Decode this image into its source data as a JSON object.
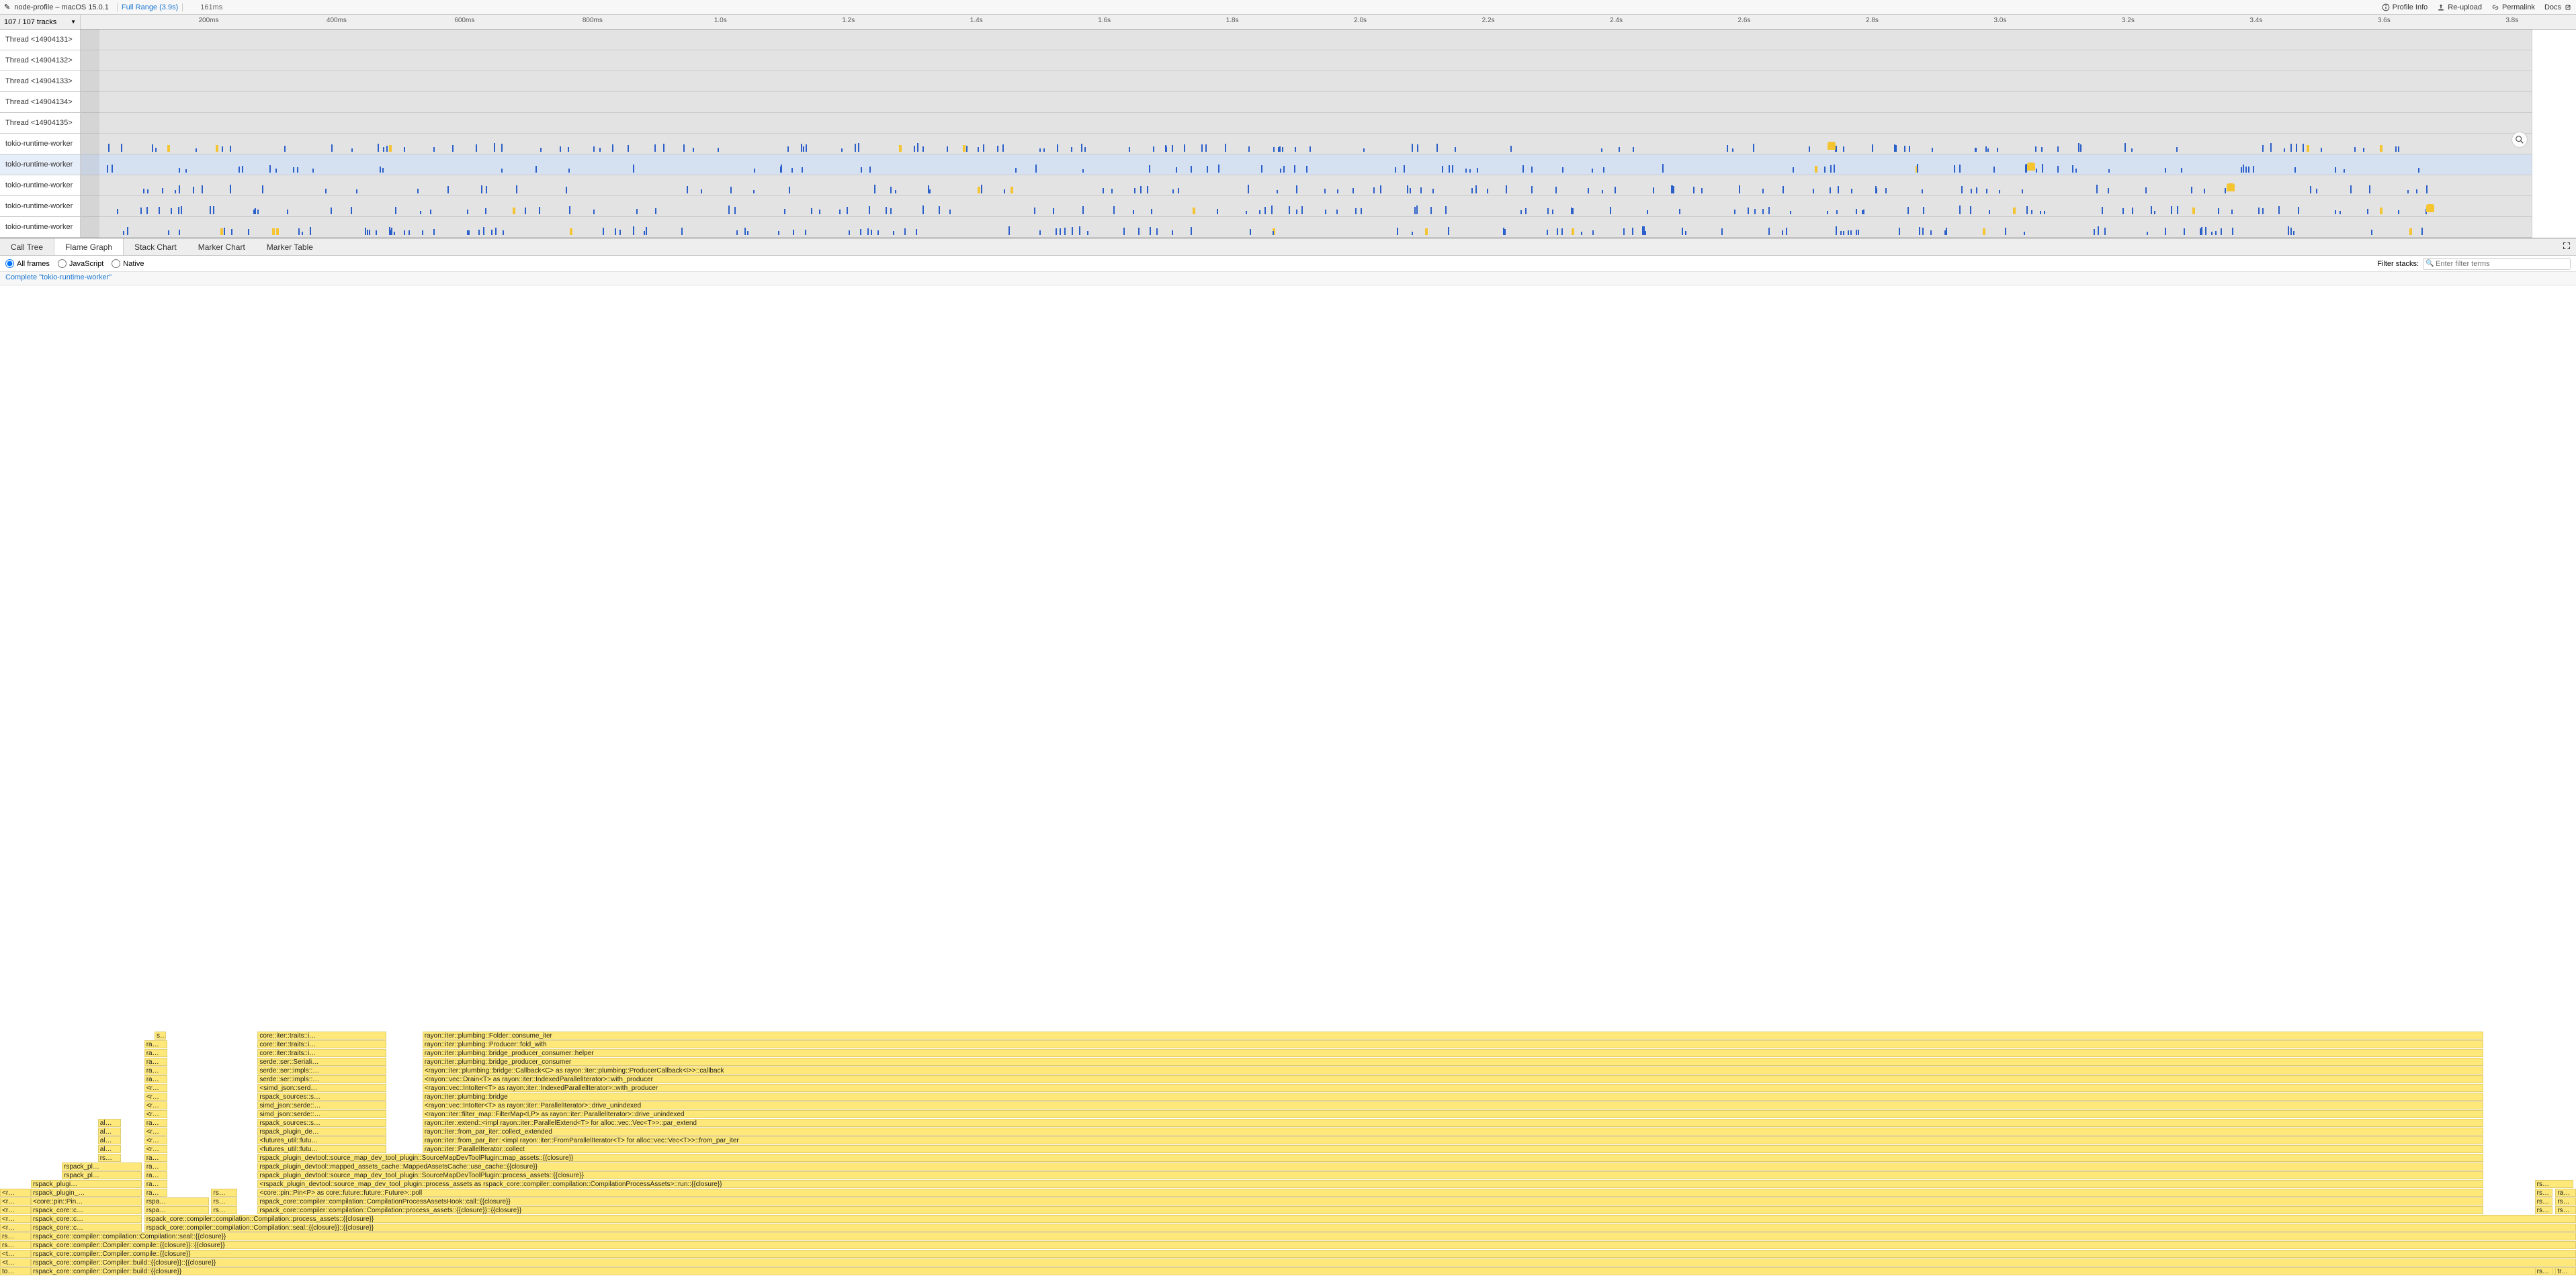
{
  "header": {
    "title": "node-profile – macOS 15.0.1",
    "range_link": "Full Range (3.9s)",
    "duration": "161ms",
    "actions": {
      "profile_info": "Profile Info",
      "reupload": "Re-upload",
      "permalink": "Permalink",
      "docs": "Docs"
    }
  },
  "tracks_label": "107 / 107 tracks",
  "ruler_ticks": [
    "200ms",
    "400ms",
    "600ms",
    "800ms",
    "1.0s",
    "1.2s",
    "1.4s",
    "1.6s",
    "1.8s",
    "2.0s",
    "2.2s",
    "2.4s",
    "2.6s",
    "2.8s",
    "3.0s",
    "3.2s",
    "3.4s",
    "3.6s",
    "3.8s"
  ],
  "tracks": [
    {
      "name": "Thread <14904131>",
      "type": "thread"
    },
    {
      "name": "Thread <14904132>",
      "type": "thread"
    },
    {
      "name": "Thread <14904133>",
      "type": "thread"
    },
    {
      "name": "Thread <14904134>",
      "type": "thread"
    },
    {
      "name": "Thread <14904135>",
      "type": "thread"
    },
    {
      "name": "tokio-runtime-worker",
      "type": "worker",
      "selected": false
    },
    {
      "name": "tokio-runtime-worker",
      "type": "worker",
      "selected": true
    },
    {
      "name": "tokio-runtime-worker",
      "type": "worker",
      "selected": false
    },
    {
      "name": "tokio-runtime-worker",
      "type": "worker",
      "selected": false
    },
    {
      "name": "tokio-runtime-worker",
      "type": "worker",
      "selected": false
    }
  ],
  "bottom_tabs": [
    "Call Tree",
    "Flame Graph",
    "Stack Chart",
    "Marker Chart",
    "Marker Table"
  ],
  "bottom_active_tab": "Flame Graph",
  "filter": {
    "opts": {
      "all": "All frames",
      "js": "JavaScript",
      "native": "Native"
    },
    "selected": "all",
    "label": "Filter stacks:",
    "placeholder": "Enter filter terms"
  },
  "crumb": "Complete \"tokio-runtime-worker\"",
  "flame_rows": [
    [
      {
        "l": 6.0,
        "w": 0.45,
        "t": "st…"
      },
      {
        "l": 10.0,
        "w": 5.0,
        "t": "core::iter::traits::i…"
      },
      {
        "l": 16.4,
        "w": 80,
        "t": "rayon::iter::plumbing::Folder::consume_iter"
      }
    ],
    [
      {
        "l": 5.6,
        "w": 0.9,
        "t": "ra…"
      },
      {
        "l": 10.0,
        "w": 5.0,
        "t": "core::iter::traits::i…"
      },
      {
        "l": 16.4,
        "w": 80,
        "t": "rayon::iter::plumbing::Producer::fold_with"
      }
    ],
    [
      {
        "l": 5.6,
        "w": 0.9,
        "t": "ra…"
      },
      {
        "l": 10.0,
        "w": 5.0,
        "t": "core::iter::traits::i…"
      },
      {
        "l": 16.4,
        "w": 80,
        "t": "rayon::iter::plumbing::bridge_producer_consumer::helper"
      }
    ],
    [
      {
        "l": 5.6,
        "w": 0.9,
        "t": "ra…"
      },
      {
        "l": 10.0,
        "w": 5.0,
        "t": "serde::ser::Seriali…"
      },
      {
        "l": 16.4,
        "w": 80,
        "t": "rayon::iter::plumbing::bridge_producer_consumer"
      }
    ],
    [
      {
        "l": 5.6,
        "w": 0.9,
        "t": "ra…"
      },
      {
        "l": 10.0,
        "w": 5.0,
        "t": "serde::ser::impls::…"
      },
      {
        "l": 16.4,
        "w": 80,
        "t": "<rayon::iter::plumbing::bridge::Callback<C> as rayon::iter::plumbing::ProducerCallback<I>>::callback"
      }
    ],
    [
      {
        "l": 5.6,
        "w": 0.9,
        "t": "ra…"
      },
      {
        "l": 10.0,
        "w": 5.0,
        "t": "serde::ser::impls::…"
      },
      {
        "l": 16.4,
        "w": 80,
        "t": "<rayon::vec::Drain<T> as rayon::iter::IndexedParallelIterator>::with_producer"
      }
    ],
    [
      {
        "l": 5.6,
        "w": 0.9,
        "t": "<r…"
      },
      {
        "l": 10.0,
        "w": 5.0,
        "t": "<simd_json::serd…"
      },
      {
        "l": 16.4,
        "w": 80,
        "t": "<rayon::vec::IntoIter<T> as rayon::iter::IndexedParallelIterator>::with_producer"
      }
    ],
    [
      {
        "l": 5.6,
        "w": 0.9,
        "t": "<r…"
      },
      {
        "l": 10.0,
        "w": 5.0,
        "t": "rspack_sources::s…"
      },
      {
        "l": 16.4,
        "w": 80,
        "t": "rayon::iter::plumbing::bridge"
      }
    ],
    [
      {
        "l": 5.6,
        "w": 0.9,
        "t": "<r…"
      },
      {
        "l": 10.0,
        "w": 5.0,
        "t": "simd_json::serde::…"
      },
      {
        "l": 16.4,
        "w": 80,
        "t": "<rayon::vec::IntoIter<T> as rayon::iter::ParallelIterator>::drive_unindexed"
      }
    ],
    [
      {
        "l": 5.6,
        "w": 0.9,
        "t": "<r…"
      },
      {
        "l": 10.0,
        "w": 5.0,
        "t": "simd_json::serde::…"
      },
      {
        "l": 16.4,
        "w": 80,
        "t": "<rayon::iter::filter_map::FilterMap<I,P> as rayon::iter::ParallelIterator>::drive_unindexed"
      }
    ],
    [
      {
        "l": 3.8,
        "w": 0.9,
        "t": "al…"
      },
      {
        "l": 5.6,
        "w": 0.9,
        "t": "ra…"
      },
      {
        "l": 10.0,
        "w": 5.0,
        "t": "rspack_sources::s…"
      },
      {
        "l": 16.4,
        "w": 80,
        "t": "rayon::iter::extend::<impl rayon::iter::ParallelExtend<T> for alloc::vec::Vec<T>>::par_extend"
      }
    ],
    [
      {
        "l": 3.8,
        "w": 0.9,
        "t": "al…"
      },
      {
        "l": 5.6,
        "w": 0.9,
        "t": "<r…"
      },
      {
        "l": 10.0,
        "w": 5.0,
        "t": "rspack_plugin_de…"
      },
      {
        "l": 16.4,
        "w": 80,
        "t": "rayon::iter::from_par_iter::collect_extended"
      }
    ],
    [
      {
        "l": 3.8,
        "w": 0.9,
        "t": "al…"
      },
      {
        "l": 5.6,
        "w": 0.9,
        "t": "<r…"
      },
      {
        "l": 10.0,
        "w": 5.0,
        "t": "<futures_util::futu…"
      },
      {
        "l": 16.4,
        "w": 80,
        "t": "rayon::iter::from_par_iter::<impl rayon::iter::FromParallelIterator<T> for alloc::vec::Vec<T>>::from_par_iter"
      }
    ],
    [
      {
        "l": 3.8,
        "w": 0.9,
        "t": "al…"
      },
      {
        "l": 5.6,
        "w": 0.9,
        "t": "<r…"
      },
      {
        "l": 10.0,
        "w": 5.0,
        "t": "<futures_util::futu…"
      },
      {
        "l": 16.4,
        "w": 80,
        "t": "rayon::iter::ParallelIterator::collect"
      }
    ],
    [
      {
        "l": 3.8,
        "w": 0.9,
        "t": "rs…"
      },
      {
        "l": 5.6,
        "w": 0.9,
        "t": "ra…"
      },
      {
        "l": 10.0,
        "w": 86.4,
        "t": "rspack_plugin_devtool::source_map_dev_tool_plugin::SourceMapDevToolPlugin::map_assets::{{closure}}"
      }
    ],
    [
      {
        "l": 2.4,
        "w": 3.1,
        "t": "rspack_pl…"
      },
      {
        "l": 5.6,
        "w": 0.9,
        "t": "ra…"
      },
      {
        "l": 10.0,
        "w": 86.4,
        "t": "rspack_plugin_devtool::mapped_assets_cache::MappedAssetsCache::use_cache::{{closure}}"
      }
    ],
    [
      {
        "l": 2.4,
        "w": 3.1,
        "t": "rspack_pl…"
      },
      {
        "l": 5.6,
        "w": 0.9,
        "t": "ra…"
      },
      {
        "l": 10.0,
        "w": 86.4,
        "t": "rspack_plugin_devtool::source_map_dev_tool_plugin::SourceMapDevToolPlugin::process_assets::{{closure}}"
      }
    ],
    [
      {
        "l": 1.2,
        "w": 4.3,
        "t": "rspack_plugi…"
      },
      {
        "l": 5.6,
        "w": 0.9,
        "t": "ra…"
      },
      {
        "l": 10.0,
        "w": 86.4,
        "t": "<rspack_plugin_devtool::source_map_dev_tool_plugin::process_assets as rspack_core::compiler::compilation::CompilationProcessAssets>::run::{{closure}}"
      },
      {
        "l": 98.4,
        "w": 1.5,
        "t": "rs…"
      }
    ],
    [
      {
        "l": 0,
        "w": 1.2,
        "t": "<r…"
      },
      {
        "l": 1.2,
        "w": 4.3,
        "t": "rspack_plugin_…"
      },
      {
        "l": 5.6,
        "w": 0.9,
        "t": "ra…"
      },
      {
        "l": 8.2,
        "w": 1.0,
        "t": "rs…"
      },
      {
        "l": 10.0,
        "w": 86.4,
        "t": "<core::pin::Pin<P> as core::future::future::Future>::poll"
      },
      {
        "l": 98.4,
        "w": 0.7,
        "t": "rs…"
      },
      {
        "l": 99.2,
        "w": 0.8,
        "t": "ra…"
      }
    ],
    [
      {
        "l": 0,
        "w": 1.2,
        "t": "<r…"
      },
      {
        "l": 1.2,
        "w": 4.3,
        "t": "<core::pin::Pin…"
      },
      {
        "l": 5.6,
        "w": 2.5,
        "t": "rspa…"
      },
      {
        "l": 8.2,
        "w": 1.0,
        "t": "rs…"
      },
      {
        "l": 10.0,
        "w": 86.4,
        "t": "rspack_core::compiler::compilation::CompilationProcessAssetsHook::call::{{closure}}"
      },
      {
        "l": 98.4,
        "w": 0.7,
        "t": "rs…"
      },
      {
        "l": 99.2,
        "w": 0.8,
        "t": "rs…"
      }
    ],
    [
      {
        "l": 0,
        "w": 1.2,
        "t": "<r…"
      },
      {
        "l": 1.2,
        "w": 4.3,
        "t": "rspack_core::c…"
      },
      {
        "l": 5.6,
        "w": 2.5,
        "t": "rspa…"
      },
      {
        "l": 8.2,
        "w": 1.0,
        "t": "rs…"
      },
      {
        "l": 10.0,
        "w": 86.4,
        "t": "rspack_core::compiler::compilation::Compilation::process_assets::{{closure}}::{{closure}}"
      },
      {
        "l": 98.4,
        "w": 0.7,
        "t": "rs…"
      },
      {
        "l": 99.2,
        "w": 0.8,
        "t": "rs…"
      }
    ],
    [
      {
        "l": 0,
        "w": 1.2,
        "t": "<r…"
      },
      {
        "l": 1.2,
        "w": 4.3,
        "t": "rspack_core::c…"
      },
      {
        "l": 5.6,
        "w": 94.4,
        "t": "rspack_core::compiler::compilation::Compilation::process_assets::{{closure}}"
      }
    ],
    [
      {
        "l": 0,
        "w": 1.2,
        "t": "<r…"
      },
      {
        "l": 1.2,
        "w": 4.3,
        "t": "rspack_core::c…"
      },
      {
        "l": 5.6,
        "w": 94.4,
        "t": "rspack_core::compiler::compilation::Compilation::seal::{{closure}}::{{closure}}"
      }
    ],
    [
      {
        "l": 0,
        "w": 1.2,
        "t": "rs…"
      },
      {
        "l": 1.2,
        "w": 98.8,
        "t": "rspack_core::compiler::compilation::Compilation::seal::{{closure}}"
      }
    ],
    [
      {
        "l": 0,
        "w": 1.2,
        "t": "rs…"
      },
      {
        "l": 1.2,
        "w": 98.8,
        "t": "rspack_core::compiler::Compiler::compile::{{closure}}::{{closure}}"
      }
    ],
    [
      {
        "l": 0,
        "w": 1.2,
        "t": "<t…"
      },
      {
        "l": 1.2,
        "w": 98.8,
        "t": "rspack_core::compiler::Compiler::compile::{{closure}}"
      }
    ],
    [
      {
        "l": 0,
        "w": 1.2,
        "t": "<t…"
      },
      {
        "l": 1.2,
        "w": 98.8,
        "t": "rspack_core::compiler::Compiler::build::{{closure}}::{{closure}}"
      }
    ],
    [
      {
        "l": 0,
        "w": 1.2,
        "t": "to…"
      },
      {
        "l": 1.2,
        "w": 98.8,
        "t": "rspack_core::compiler::Compiler::build::{{closure}}"
      },
      {
        "l": 98.4,
        "w": 0.7,
        "t": "rs…"
      },
      {
        "l": 99.2,
        "w": 0.8,
        "t": "tr…"
      }
    ]
  ]
}
